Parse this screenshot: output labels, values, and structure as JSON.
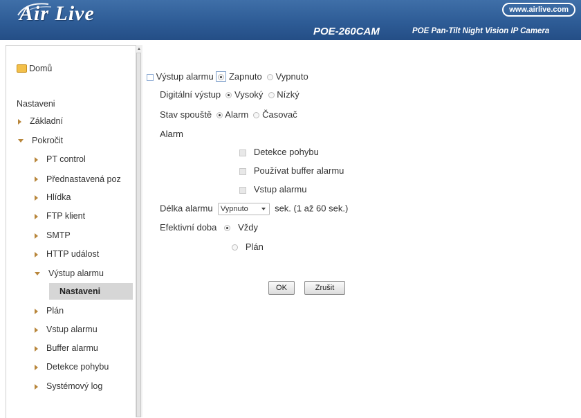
{
  "header": {
    "brand": "Air Live",
    "url": "www.airlive.com",
    "model": "POE-260CAM",
    "model_desc": "POE Pan-Tilt Night Vision IP Camera"
  },
  "sidebar": {
    "home": "Domů",
    "section": "Nastaveni",
    "items": [
      {
        "label": "Základní"
      },
      {
        "label": "Pokročit"
      },
      {
        "label": "PT control"
      },
      {
        "label": "Přednastavená poz"
      },
      {
        "label": "Hlídka"
      },
      {
        "label": "FTP klient"
      },
      {
        "label": "SMTP"
      },
      {
        "label": "HTTP událost"
      },
      {
        "label": "Výstup alarmu"
      },
      {
        "label": "Nastaveni"
      },
      {
        "label": "Plán"
      },
      {
        "label": "Vstup alarmu"
      },
      {
        "label": "Buffer alarmu"
      },
      {
        "label": "Detekce pohybu"
      },
      {
        "label": "Systémový log"
      }
    ]
  },
  "form": {
    "alarm_output_label": "Výstup alarmu",
    "on_label": "Zapnuto",
    "off_label": "Vypnuto",
    "digital_output_label": "Digitální výstup",
    "high_label": "Vysoký",
    "low_label": "Nízký",
    "trigger_label": "Stav spouště",
    "trigger_alarm": "Alarm",
    "trigger_timer": "Časovač",
    "alarm_heading": "Alarm",
    "motion_detection": "Detekce pohybu",
    "use_alarm_buffer": "Používat buffer alarmu",
    "alarm_input": "Vstup alarmu",
    "alarm_length_label": "Délka alarmu",
    "alarm_length_value": "Vypnuto",
    "alarm_length_hint": "sek. (1 až 60 sek.)",
    "effective_time_label": "Efektivní doba",
    "always_label": "Vždy",
    "schedule_label": "Plán",
    "ok_label": "OK",
    "cancel_label": "Zrušit"
  },
  "colors": {
    "header_bg": "#2e5c96",
    "selected_bg": "#d6d6d6",
    "arrow": "#b8863b"
  }
}
